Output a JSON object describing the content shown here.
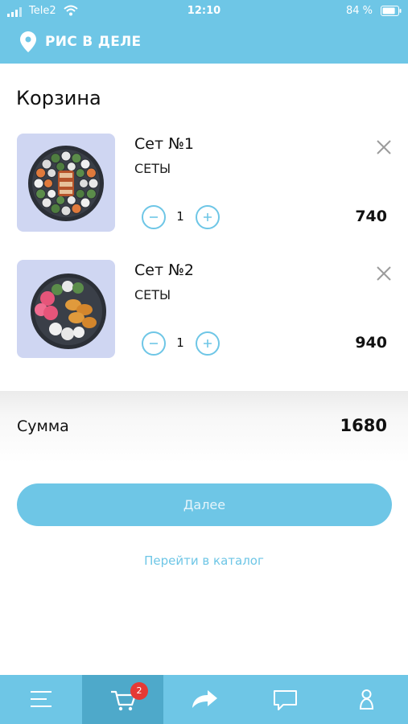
{
  "status_bar": {
    "carrier": "Tele2",
    "time": "12:10",
    "battery": "84 %",
    "battery_level": 0.84
  },
  "header": {
    "brand": "РИС В ДЕЛЕ",
    "icon": "location-pin-icon"
  },
  "cart": {
    "title": "Корзина",
    "items": [
      {
        "name": "Сет №1",
        "category": "СЕТЫ",
        "quantity": "1",
        "price": "740",
        "image": "sushi-set-platter-1"
      },
      {
        "name": "Сет №2",
        "category": "СЕТЫ",
        "quantity": "1",
        "price": "940",
        "image": "sushi-set-platter-2"
      }
    ]
  },
  "summary": {
    "label": "Сумма",
    "value": "1680"
  },
  "actions": {
    "next": "Далее",
    "catalog": "Перейти в каталог"
  },
  "tabbar": {
    "active": "cart",
    "cart_badge": "2",
    "tabs": [
      "menu-icon",
      "cart-icon",
      "share-icon",
      "chat-icon",
      "profile-icon"
    ]
  },
  "colors": {
    "accent": "#6ec6e6",
    "accent_dark": "#4ea9ca",
    "badge": "#e53935",
    "thumb_bg": "#cfd6f2"
  }
}
